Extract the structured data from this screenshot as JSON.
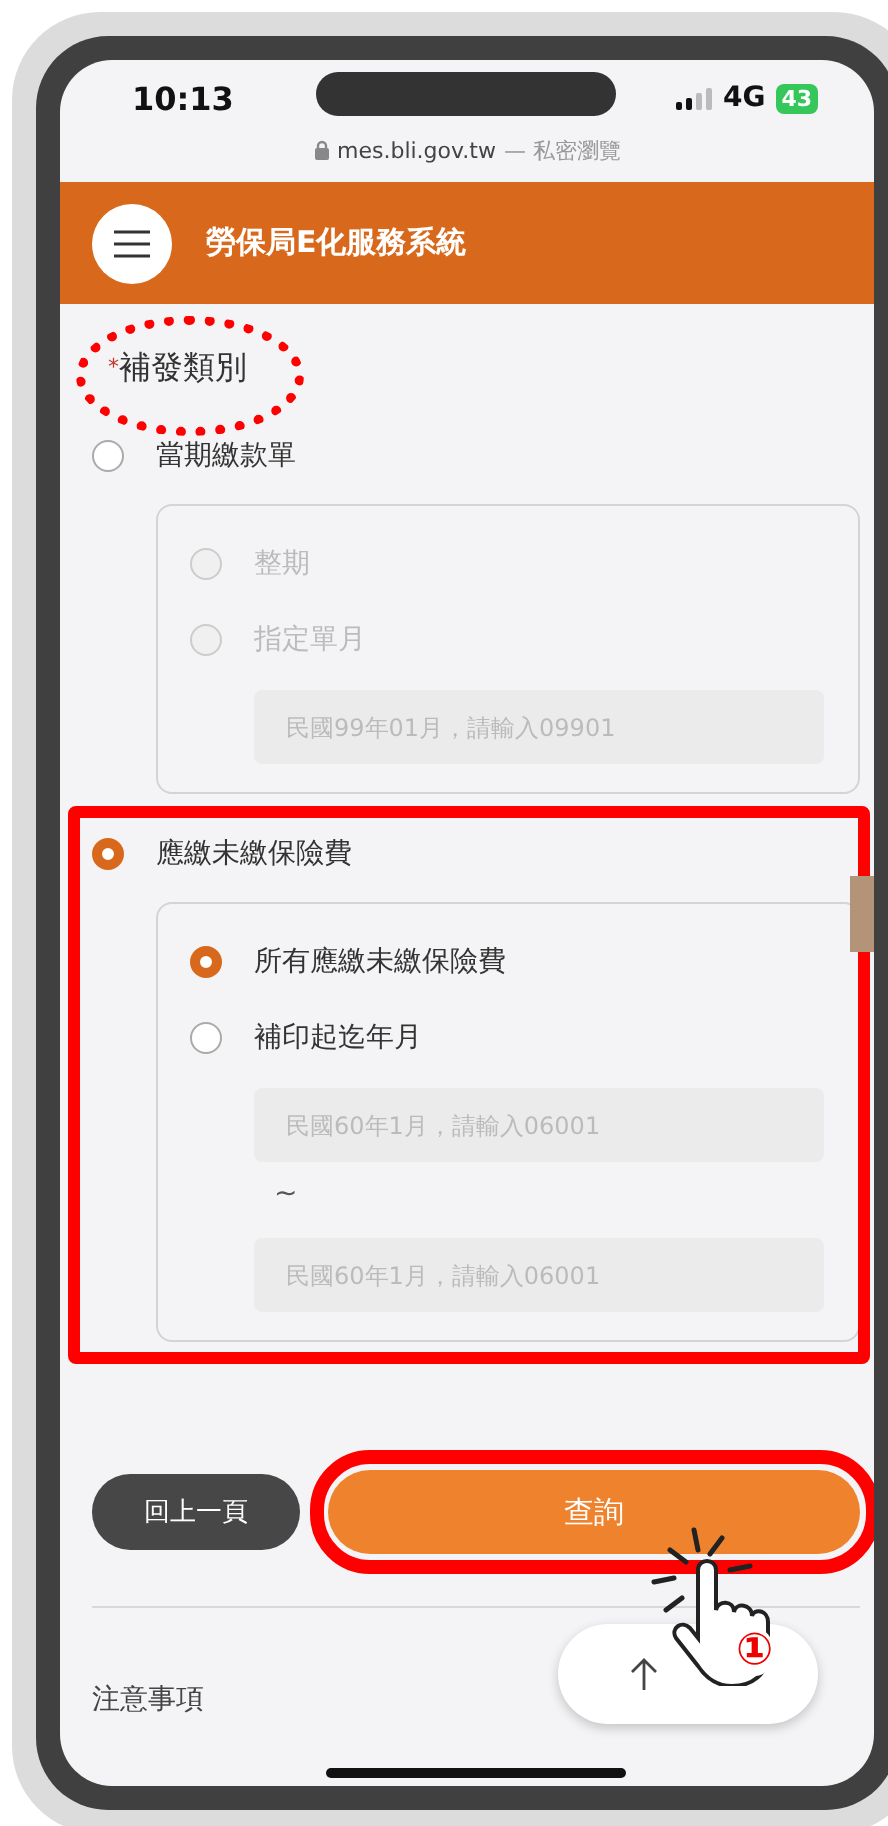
{
  "status_bar": {
    "time": "10:13",
    "network": "4G",
    "battery": "43"
  },
  "address_bar": {
    "url": "mes.bli.gov.tw",
    "mode": "— 私密瀏覽"
  },
  "header": {
    "title": "勞保局E化服務系統"
  },
  "field": {
    "required": true,
    "required_mark": "*",
    "label": "補發類別",
    "highlighted": true
  },
  "options": [
    {
      "label": "當期繳款單",
      "selected": false,
      "highlighted": false,
      "items": [
        {
          "kind": "radio",
          "label": "整期",
          "selected": false,
          "disabled": true
        },
        {
          "kind": "radio",
          "label": "指定單月",
          "selected": false,
          "disabled": true
        },
        {
          "kind": "input",
          "placeholder": "民國99年01月，請輸入09901"
        }
      ]
    },
    {
      "label": "應繳未繳保險費",
      "selected": true,
      "highlighted": true,
      "items": [
        {
          "kind": "radio",
          "label": "所有應繳未繳保險費",
          "selected": true,
          "disabled": false
        },
        {
          "kind": "radio",
          "label": "補印起迄年月",
          "selected": false,
          "disabled": false
        },
        {
          "kind": "input",
          "placeholder": "民國60年1月，請輸入06001"
        },
        {
          "kind": "separator",
          "text": "~"
        },
        {
          "kind": "input",
          "placeholder": "民國60年1月，請輸入06001"
        }
      ]
    }
  ],
  "buttons": {
    "back": "回上一頁",
    "query": "查詢",
    "query_highlighted": true
  },
  "tap_hint": {
    "step": "①"
  },
  "notes": {
    "heading": "注意事項"
  }
}
